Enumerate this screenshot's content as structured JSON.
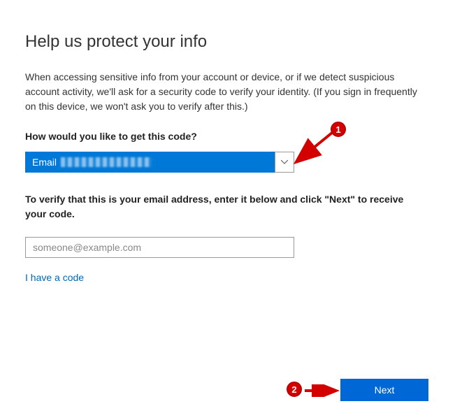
{
  "title": "Help us protect your info",
  "description": "When accessing sensitive info from your account or device, or if we detect suspicious account activity, we'll ask for a security code to verify your identity. (If you sign in frequently on this device, we won't ask you to verify after this.)",
  "prompt_label": "How would you like to get this code?",
  "dropdown": {
    "selected_prefix": "Email"
  },
  "verify_text": "To verify that this is your email address, enter it below and click \"Next\" to receive your code.",
  "email_input": {
    "placeholder": "someone@example.com",
    "value": ""
  },
  "have_code_link": "I have a code",
  "next_button": "Next",
  "annotations": {
    "badge1": "1",
    "badge2": "2"
  },
  "colors": {
    "primary": "#0078d7",
    "accent_red": "#d40000",
    "link": "#0067b8"
  }
}
